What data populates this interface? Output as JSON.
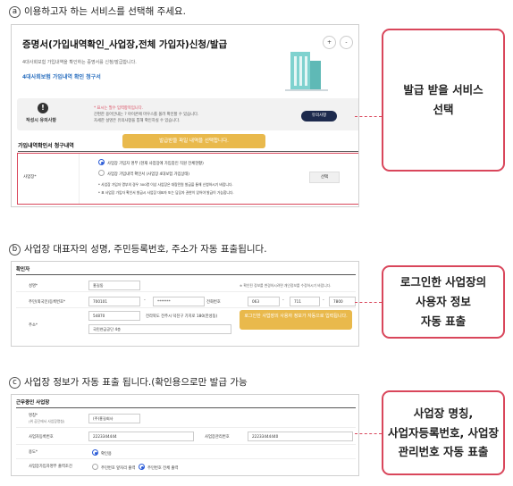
{
  "step1": {
    "marker": "a",
    "text": "이용하고자 하는 서비스를 선택해 주세요."
  },
  "step2": {
    "marker": "b",
    "text": "사업장 대표자의 성명, 주민등록번호, 주소가 자동 표출됩니다."
  },
  "step3": {
    "marker": "c",
    "text": "사업장 정보가 자동 표출 됩니다.(확인용으로만 발급 가능"
  },
  "callout1": {
    "line1": "발급 받을 서비스",
    "line2": "선택"
  },
  "callout2": {
    "line1": "로그인한 사업장의",
    "line2": "사용자 정보",
    "line3": "자동 표출"
  },
  "callout3": {
    "line1": "사업장 명칭,",
    "line2": "사업자등록번호, 사업장",
    "line3": "관리번호 자동 표출"
  },
  "screen1": {
    "title": "증명서(가입내역확인_사업장,전체 가입자)신청/발급",
    "zoom_in": "+",
    "zoom_out": "-",
    "desc": "4대사회보험 가입내역을 확인하는 증명서를 신청/발급합니다.",
    "subtitle": "4대사회보험 가입내역 확인 청구서",
    "notice_icon": "!",
    "notice_label": "작성시 유의사항",
    "notice_lines": [
      "* 표시는 필수 입력항목입니다.",
      "간편한 용어안내는 ? 아이콘에 마우스를 올려 확인할 수 있습니다.",
      "자세한 설명은 유의사항을 통해 확인하실 수 있습니다."
    ],
    "notice_button": "유의사항",
    "section_title": "가입내역확인서 청구내역",
    "tooltip": "발급받을 파일 내역을 선택합니다.",
    "field_label": "사업장*",
    "option1": "사업장 가입자 명부 (현재 사업장에 가입중인 직원 전체현황)",
    "option2": "사업장 가입내역 확인서 (사업장 4대보험 가입상태)",
    "note1": "* 사업장 가입자 명부의 경우 300명 이상 사업장은 대량민원 발급을 통해 신청하시기 바랍니다.",
    "note2": "* 표 사업장 가입자 확인서 발급시 사업장 대표자 또는 담당자 권한이 있어야 발급이 가능합니다.",
    "search_button": "선택"
  },
  "screen2": {
    "title": "확인자",
    "name_label": "성명*",
    "name_value": "홍길동",
    "name_note": "※ 확인된 정보를 변경하시려면 개인정보를 수정하시기 바랍니다.",
    "rrn_label": "주민(외국인)등록번호*",
    "rrn_front": "700101",
    "rrn_back": "*******",
    "phone_label": "전화번호",
    "phone1": "063",
    "phone2": "711",
    "phone3": "7800",
    "dash": "-",
    "addr_label": "주소*",
    "postcode": "54870",
    "addr1": "전라북도 전주시 덕진구 기지로 180(만성동)",
    "addr2": "국민연금공단 4층",
    "tooltip": "로그인한 사업장의 사용자 정보가 자동으로 입력됩니다."
  },
  "screen3": {
    "title": "근무중인 사업장",
    "name_label": "명칭*",
    "name_label2": "(위 공단에서 사업장명칭)",
    "name_value": "(주)홍길회사",
    "bizno_label": "사업자등록번호",
    "bizno_value": "2223344444",
    "mgmt_label": "사업장관리번호",
    "mgmt_value": "22233444440",
    "purpose_label": "용도*",
    "purpose_value": "확인용",
    "id_label": "사업장가입자명부 출력조건",
    "id_opt1": "주민번호 앞자리 출력",
    "id_opt2": "주민번호 전체 출력"
  }
}
